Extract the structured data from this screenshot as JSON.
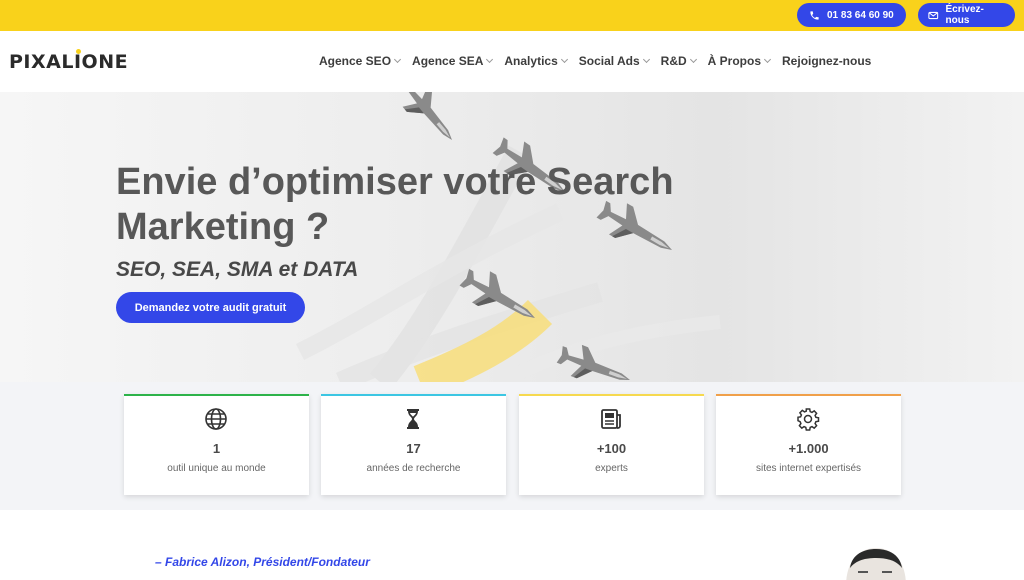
{
  "topbar": {
    "phone_label": "01 83 64 60 90",
    "mail_label": "Écrivez-nous",
    "color": "#f9d21b",
    "button_color": "#3347e8"
  },
  "header": {
    "logo_pre": "PIXAL",
    "logo_i": "I",
    "logo_post": "ONE",
    "nav": [
      {
        "label": "Agence SEO",
        "dropdown": true
      },
      {
        "label": "Agence SEA",
        "dropdown": true
      },
      {
        "label": "Analytics",
        "dropdown": true
      },
      {
        "label": "Social Ads",
        "dropdown": true
      },
      {
        "label": "R&D",
        "dropdown": true
      },
      {
        "label": "À Propos",
        "dropdown": true
      },
      {
        "label": "Rejoignez-nous",
        "dropdown": false
      }
    ]
  },
  "hero": {
    "title": "Envie d’optimiser votre Search Marketing ?",
    "subtitle": "SEO, SEA, SMA et DATA",
    "cta_label": "Demandez votre audit gratuit"
  },
  "stats": [
    {
      "icon": "globe-icon",
      "value": "1",
      "label": "outil unique au monde",
      "color": "#2db34a"
    },
    {
      "icon": "hourglass-icon",
      "value": "17",
      "label": "années de recherche",
      "color": "#3cc6e3"
    },
    {
      "icon": "newspaper-icon",
      "value": "+100",
      "label": "experts",
      "color": "#f6d94f"
    },
    {
      "icon": "gear-icon",
      "value": "+1.000",
      "label": "sites internet expertisés",
      "color": "#f0a04a"
    }
  ],
  "quote": {
    "author": "– Fabrice Alizon, Président/Fondateur"
  }
}
